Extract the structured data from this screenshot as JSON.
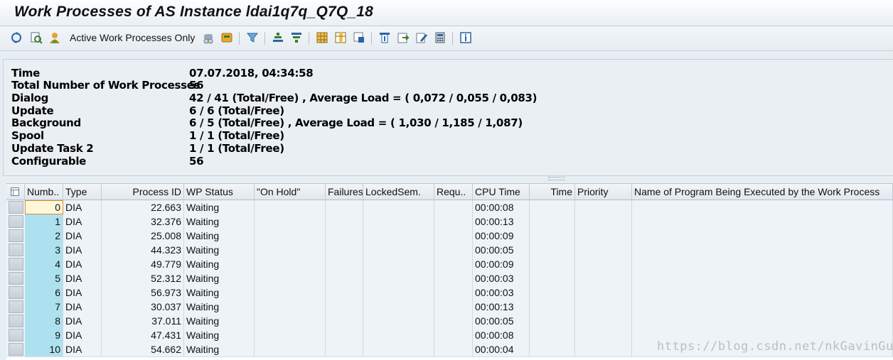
{
  "window": {
    "title": "Work Processes of AS Instance ldai1q7q_Q7Q_18"
  },
  "toolbar": {
    "active_only_label": "Active Work Processes Only",
    "icons": [
      "refresh-icon",
      "details-icon",
      "stop-icon",
      "active-filter-icon",
      "debug-icon",
      "log-icon",
      "filter-icon",
      "sort-asc-icon",
      "sort-desc-icon",
      "grid-icon",
      "columns-icon",
      "export-icon",
      "print-icon",
      "excel-icon",
      "edit-icon",
      "calculator-icon",
      "info-icon"
    ]
  },
  "info": {
    "rows": [
      {
        "label": "Time",
        "value": "07.07.2018, 04:34:58"
      },
      {
        "label": "Total Number of Work Processes",
        "value": "56"
      },
      {
        "label": "Dialog",
        "value": "42 / 41 (Total/Free) , Average Load = ( 0,072 / 0,055 / 0,083)"
      },
      {
        "label": "Update",
        "value": "6 / 6 (Total/Free)"
      },
      {
        "label": "Background",
        "value": "6 / 5 (Total/Free) , Average Load = ( 1,030 / 1,185 / 1,087)"
      },
      {
        "label": "Spool",
        "value": "1 / 1 (Total/Free)"
      },
      {
        "label": "Update Task 2",
        "value": "1 / 1 (Total/Free)"
      },
      {
        "label": "Configurable",
        "value": "56"
      }
    ]
  },
  "table": {
    "columns": [
      "Numb..",
      "Type",
      "Process ID",
      "WP Status",
      "\"On Hold\"",
      "Failures",
      "LockedSem.",
      "Requ..",
      "CPU Time",
      "Time",
      "Priority",
      "Name of Program Being Executed by the Work Process"
    ],
    "rows": [
      {
        "num": "0",
        "type": "DIA",
        "pid": "22.663",
        "status": "Waiting",
        "cpu": "00:00:08"
      },
      {
        "num": "1",
        "type": "DIA",
        "pid": "32.376",
        "status": "Waiting",
        "cpu": "00:00:13"
      },
      {
        "num": "2",
        "type": "DIA",
        "pid": "25.008",
        "status": "Waiting",
        "cpu": "00:00:09"
      },
      {
        "num": "3",
        "type": "DIA",
        "pid": "44.323",
        "status": "Waiting",
        "cpu": "00:00:05"
      },
      {
        "num": "4",
        "type": "DIA",
        "pid": "49.779",
        "status": "Waiting",
        "cpu": "00:00:09"
      },
      {
        "num": "5",
        "type": "DIA",
        "pid": "52.312",
        "status": "Waiting",
        "cpu": "00:00:03"
      },
      {
        "num": "6",
        "type": "DIA",
        "pid": "56.973",
        "status": "Waiting",
        "cpu": "00:00:03"
      },
      {
        "num": "7",
        "type": "DIA",
        "pid": "30.037",
        "status": "Waiting",
        "cpu": "00:00:13"
      },
      {
        "num": "8",
        "type": "DIA",
        "pid": "37.011",
        "status": "Waiting",
        "cpu": "00:00:05"
      },
      {
        "num": "9",
        "type": "DIA",
        "pid": "47.431",
        "status": "Waiting",
        "cpu": "00:00:08"
      },
      {
        "num": "10",
        "type": "DIA",
        "pid": "54.662",
        "status": "Waiting",
        "cpu": "00:00:04"
      }
    ]
  },
  "watermark": "https://blog.csdn.net/nkGavinGuo"
}
